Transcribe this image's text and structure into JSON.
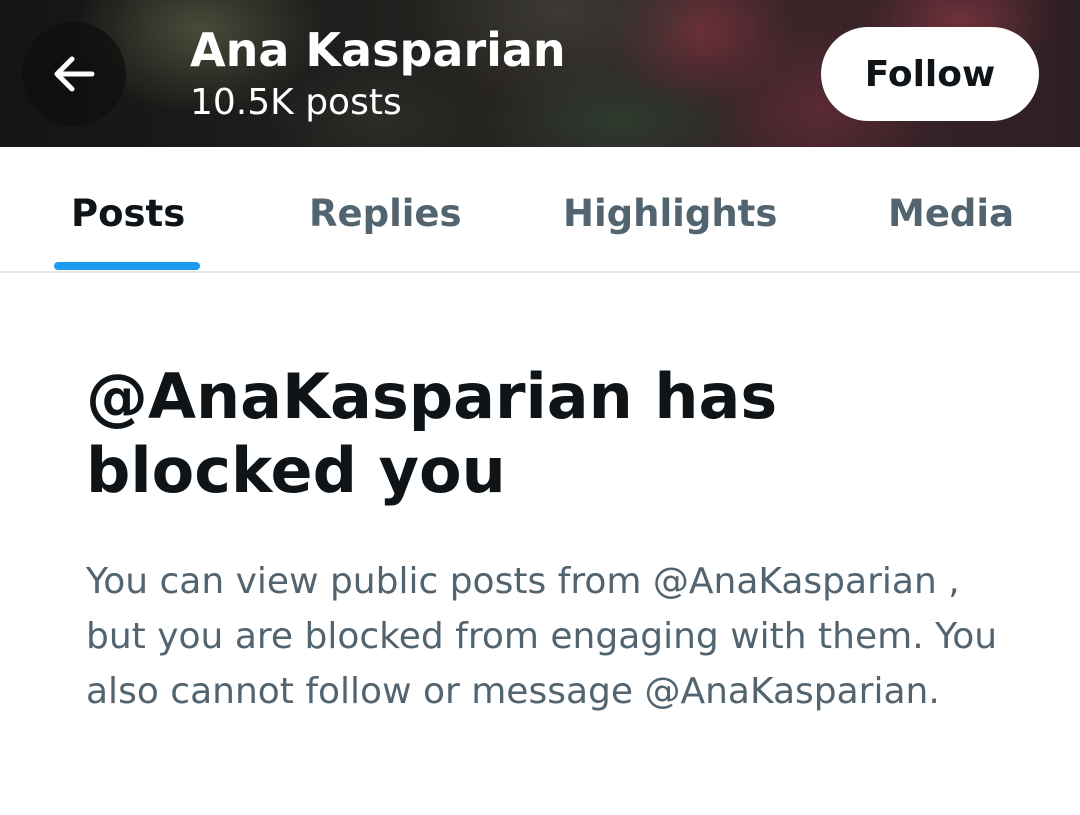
{
  "header": {
    "back_icon": "arrow-left-icon",
    "profile_name": "Ana Kasparian",
    "post_count": "10.5K posts",
    "follow_label": "Follow"
  },
  "tabs": [
    {
      "label": "Posts",
      "active": true
    },
    {
      "label": "Replies",
      "active": false
    },
    {
      "label": "Highlights",
      "active": false
    },
    {
      "label": "Media",
      "active": false
    }
  ],
  "notice": {
    "title": "@AnaKasparian has blocked you",
    "description": "You can view public posts from @AnaKasparian , but you are blocked from engaging with them. You also cannot follow or message @AnaKasparian."
  },
  "colors": {
    "accent": "#1d9bf0",
    "text_primary": "#0f1419",
    "text_secondary": "#536471"
  }
}
